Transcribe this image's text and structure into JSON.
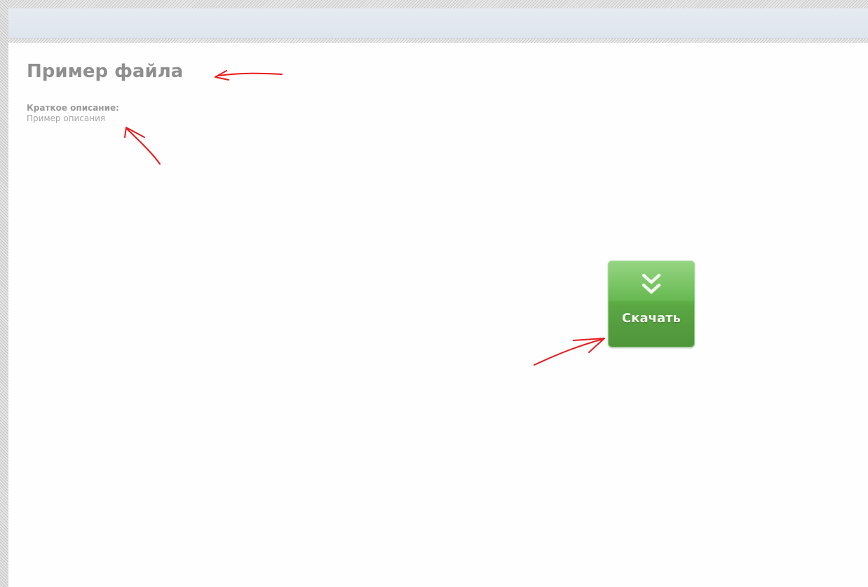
{
  "file": {
    "title": "Пример файла",
    "description_label": "Краткое описание:",
    "description_value": "Пример описания"
  },
  "download": {
    "label": "Скачать",
    "icon": "double-chevron-down-icon",
    "color": "#5eb547"
  },
  "annotation_color": "#e8181b"
}
